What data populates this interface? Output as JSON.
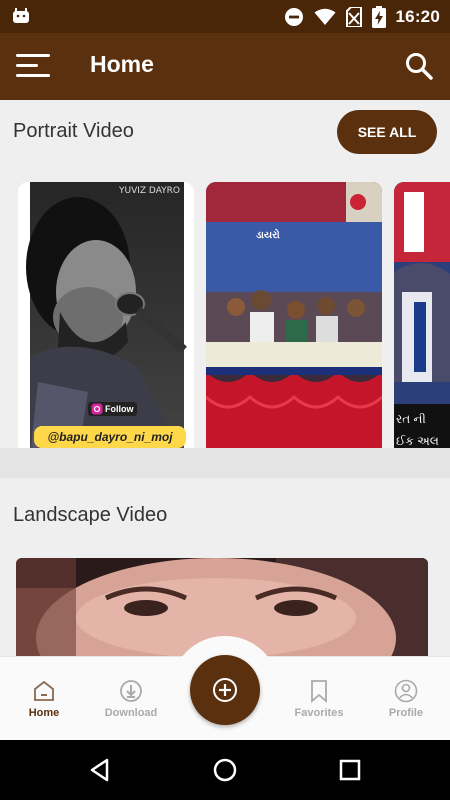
{
  "status_bar": {
    "time": "16:20",
    "icons": [
      "android-icon",
      "do-not-disturb-icon",
      "wifi-icon",
      "no-sim-icon",
      "battery-charging-icon"
    ]
  },
  "app_bar": {
    "title": "Home",
    "menu_icon": "hamburger-menu-icon",
    "search_icon": "search-icon"
  },
  "portrait_section": {
    "title": "Portrait Video",
    "see_all_label": "SEE ALL",
    "cards": [
      {
        "watermark": "YUVIZ DAYRO",
        "follow": "Follow",
        "handle": "@bapu_dayro_ni_moj"
      },
      {
        "banner": "ડાયરો"
      },
      {
        "caption1": "રત ની",
        "caption2": "ઈક અલ"
      }
    ]
  },
  "landscape_section": {
    "title": "Landscape Video"
  },
  "bottom_nav": {
    "items": [
      {
        "label": "Home",
        "icon": "home-icon",
        "active": true
      },
      {
        "label": "Download",
        "icon": "download-icon",
        "active": false
      },
      {
        "label": "Favorites",
        "icon": "bookmark-icon",
        "active": false
      },
      {
        "label": "Profile",
        "icon": "profile-icon",
        "active": false
      }
    ],
    "fab_icon": "add-circle-icon"
  },
  "system_nav": {
    "icons": [
      "back-icon",
      "home-circle-icon",
      "recents-icon"
    ]
  },
  "colors": {
    "primary": "#5a300f",
    "status_bar": "#4a2608",
    "background": "#efefef"
  }
}
